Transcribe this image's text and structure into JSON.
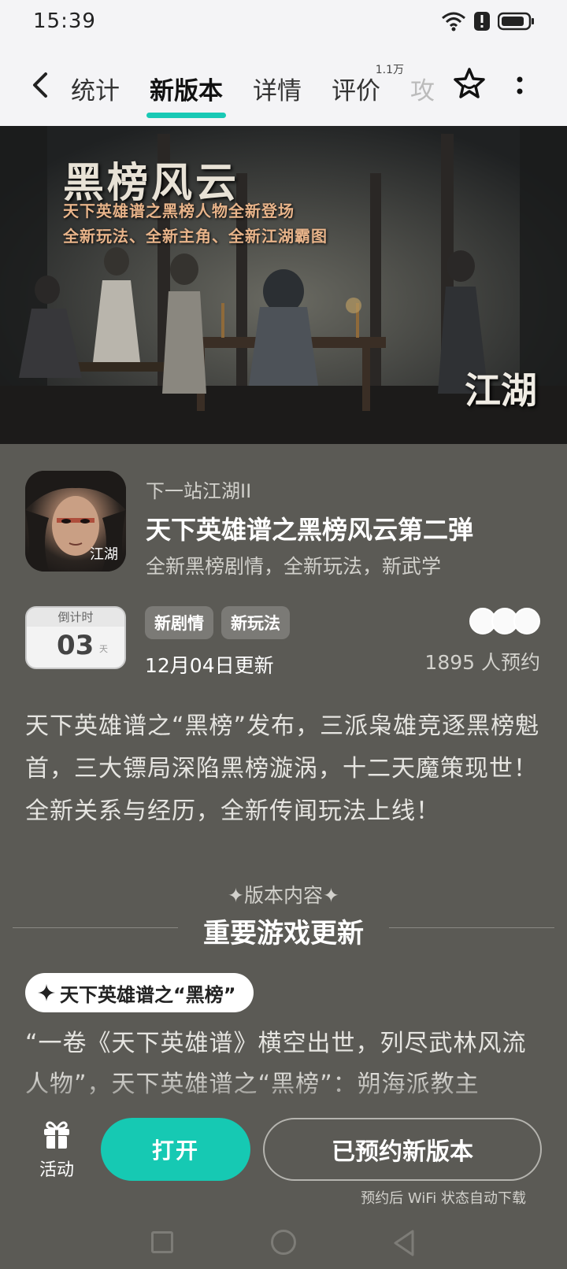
{
  "status_bar": {
    "time": "15:39"
  },
  "nav": {
    "tabs": [
      {
        "label": "统计"
      },
      {
        "label": "新版本",
        "active": true
      },
      {
        "label": "详情"
      },
      {
        "label": "评价",
        "badge": "1.1万"
      },
      {
        "label": "攻"
      }
    ]
  },
  "banner": {
    "title": "黑榜风云",
    "subtitle_line1": "天下英雄谱之黑榜人物全新登场",
    "subtitle_line2": "全新玩法、全新主角、全新江湖霸图",
    "logo_text": "江湖"
  },
  "app": {
    "name": "下一站江湖II",
    "headline": "天下英雄谱之黑榜风云第二弹",
    "description": "全新黑榜剧情，全新玩法，新武学",
    "icon_text": "江湖"
  },
  "countdown": {
    "label": "倒计时",
    "value": "03",
    "unit": "天"
  },
  "tags": [
    "新剧情",
    "新玩法"
  ],
  "update_date": "12月04日更新",
  "reservations": "1895 人预约",
  "version_description": "天下英雄谱之“黑榜”发布，三派枭雄竞逐黑榜魁首，三大镖局深陷黑榜漩涡，十二天魔策现世！全新关系与经历，全新传闻玩法上线！",
  "section": {
    "kicker": "✦版本内容✦",
    "title": "重要游戏更新"
  },
  "highlight": {
    "pill_label": "天下英雄谱之“黑榜”",
    "text": "“一卷《天下英雄谱》横空出世，列尽武林风流人物”，天下英雄谱之“黑榜”：朔海派教主"
  },
  "bottom_bar": {
    "activity_label": "活动",
    "open_button": "打开",
    "reserved_button": "已预约新版本",
    "wifi_note": "预约后 WiFi 状态自动下载"
  },
  "colors": {
    "accent": "#19c9b5",
    "background": "#5b5a55",
    "header_bg": "#f4f4f6"
  }
}
